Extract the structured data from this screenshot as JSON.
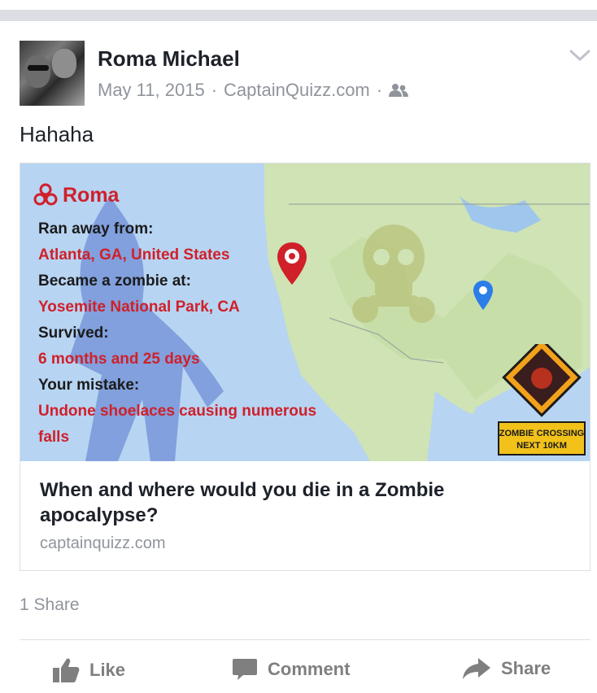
{
  "post": {
    "author": "Roma Michael",
    "date": "May 11, 2015",
    "separator": "·",
    "app": "CaptainQuizz.com",
    "audience_icon": "friends-icon",
    "message": "Hahaha"
  },
  "card": {
    "image": {
      "name": "Roma",
      "lines": [
        {
          "text": "Ran away from:",
          "style": "black"
        },
        {
          "text": "Atlanta, GA, United States",
          "style": "red"
        },
        {
          "text": "Became a zombie at:",
          "style": "black"
        },
        {
          "text": "Yosemite National Park, CA",
          "style": "red"
        },
        {
          "text": "Survived:",
          "style": "black"
        },
        {
          "text": "6 months and 25 days",
          "style": "red"
        },
        {
          "text": "Your mistake:",
          "style": "black"
        },
        {
          "text": "Undone shoelaces causing numerous",
          "style": "red"
        },
        {
          "text": "falls",
          "style": "red"
        }
      ],
      "sign_line1": "ZOMBIE CROSSING",
      "sign_line2": "NEXT 10KM"
    },
    "title": "When and where would you die in a Zombie apocalypse?",
    "domain": "captainquizz.com"
  },
  "stats": {
    "shares": "1 Share"
  },
  "actions": {
    "like": "Like",
    "comment": "Comment",
    "share": "Share"
  },
  "colors": {
    "accent_red": "#d0202a",
    "muted": "#90949c",
    "map_water": "#b7d4f2",
    "map_land": "#cfe3b4",
    "pin_blue": "#2b7de9"
  }
}
